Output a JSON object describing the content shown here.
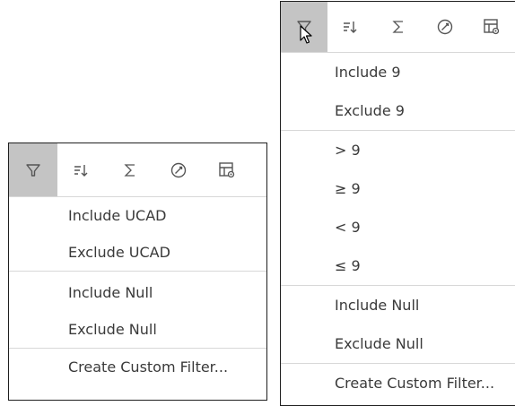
{
  "left_menu": {
    "toolbar": [
      {
        "icon": "filter-icon",
        "active": true
      },
      {
        "icon": "sort-icon",
        "active": false
      },
      {
        "icon": "sum-icon",
        "active": false
      },
      {
        "icon": "calculation-icon",
        "active": false
      },
      {
        "icon": "table-settings-icon",
        "active": false
      }
    ],
    "groups": [
      {
        "items": [
          "Include UCAD",
          "Exclude UCAD"
        ]
      },
      {
        "items": [
          "Include Null",
          "Exclude Null"
        ]
      },
      {
        "items": [
          "Create Custom Filter..."
        ]
      }
    ]
  },
  "right_menu": {
    "toolbar": [
      {
        "icon": "filter-icon",
        "active": true
      },
      {
        "icon": "sort-icon",
        "active": false
      },
      {
        "icon": "sum-icon",
        "active": false
      },
      {
        "icon": "calculation-icon",
        "active": false
      },
      {
        "icon": "table-settings-icon",
        "active": false
      }
    ],
    "groups": [
      {
        "items": [
          "Include 9",
          "Exclude 9"
        ]
      },
      {
        "items": [
          "> 9",
          "≥ 9",
          "< 9",
          "≤ 9"
        ]
      },
      {
        "items": [
          "Include Null",
          "Exclude Null"
        ]
      },
      {
        "items": [
          "Create Custom Filter..."
        ]
      }
    ]
  },
  "icons": {
    "sort_glyph": "⇂",
    "sum_glyph": "Σ"
  }
}
